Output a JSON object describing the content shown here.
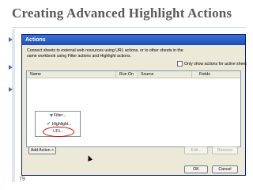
{
  "slide": {
    "title": "Creating Advanced Highlight Actions",
    "page_number": "79"
  },
  "dialog": {
    "title": "Actions",
    "description": "Connect sheets to external web resources using URL actions, or to other sheets in the same workbook using Filter actions and Highlight actions.",
    "checkbox_label": "Only show actions for active sheet",
    "columns": [
      "Name",
      "Run On",
      "Source",
      "Fields"
    ],
    "buttons": {
      "add_action": "Add Action >",
      "edit": "Edit...",
      "remove": "Remove",
      "ok": "OK",
      "cancel": "Cancel"
    },
    "menu": {
      "filter": "Filter...",
      "highlight": "Highlight...",
      "url": "URL..."
    }
  },
  "colors": {
    "title_text": "#5a5a5a",
    "accent": "#4a6fa5",
    "callout": "#d10000",
    "titlebar": "#1e4fb8"
  }
}
